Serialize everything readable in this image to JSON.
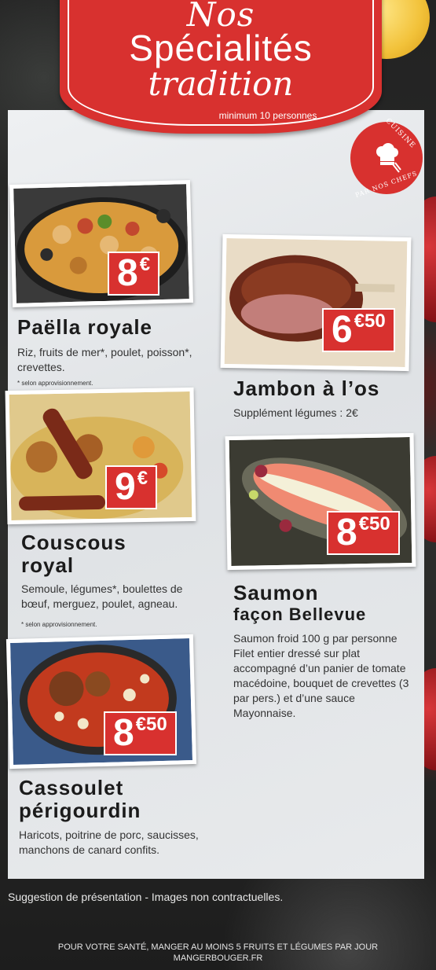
{
  "header": {
    "line1": "Nos",
    "line2": "Spécialités",
    "line3": "tradition",
    "subtitle": "minimum 10 personnes"
  },
  "badge": {
    "top": "CUISINE",
    "bottom": "PAR NOS CHEFS",
    "icon": "chef-hat-icon"
  },
  "dishes": {
    "paella": {
      "title": "Paëlla royale",
      "price_main": "8",
      "price_sup": "€",
      "desc": "Riz, fruits de mer*, poulet, poisson*, crevettes.",
      "note": "* selon approvisionnement."
    },
    "jambon": {
      "title": "Jambon à l’os",
      "price_main": "6",
      "price_sup": "€50",
      "desc": "Supplément légumes : 2€"
    },
    "couscous": {
      "title_line1": "Couscous",
      "title_line2": "royal",
      "price_main": "9",
      "price_sup": "€",
      "desc": "Semoule, légumes*, boulettes de bœuf, merguez, poulet, agneau.",
      "note": "* selon approvisionnement."
    },
    "saumon": {
      "title_line1": "Saumon",
      "title_line2": "façon Bellevue",
      "price_main": "8",
      "price_sup": "€50",
      "desc": "Saumon froid 100 g par personne Filet entier dressé sur plat accompagné d’un panier de tomate macédoine, bouquet de crevettes (3 par pers.) et d’une sauce Mayonnaise."
    },
    "cassoulet": {
      "title_line1": "Cassoulet",
      "title_line2": "périgourdin",
      "price_main": "8",
      "price_sup": "€50",
      "desc": "Haricots, poitrine de porc, saucisses, manchons de canard confits."
    }
  },
  "footer": {
    "suggestion": "Suggestion de présentation - Images non contractuelles.",
    "health_line1": "POUR VOTRE SANTÉ, MANGER AU MOINS 5 FRUITS ET LÉGUMES PAR JOUR",
    "health_line2": "MANGERBOUGER.FR"
  },
  "colors": {
    "brand_red": "#d8312f",
    "panel": "#e6e8ea",
    "background": "#2a2b2a"
  }
}
